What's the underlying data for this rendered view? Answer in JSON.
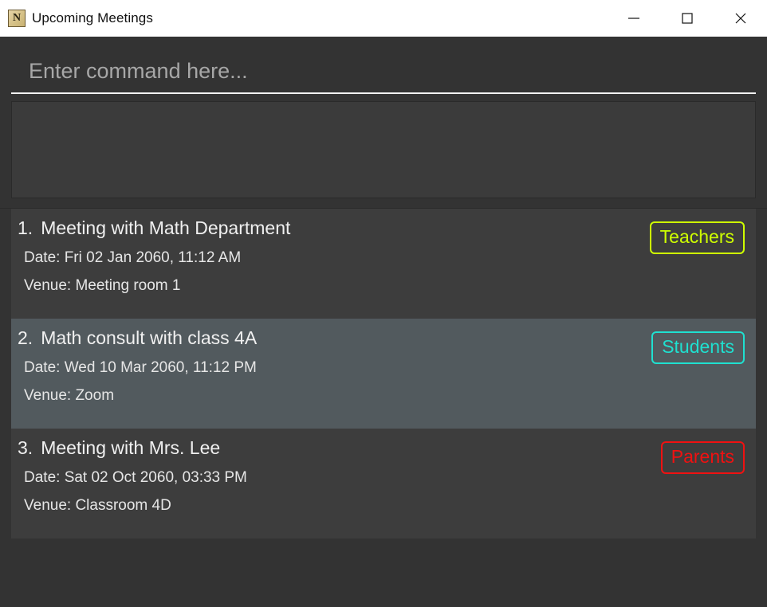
{
  "window": {
    "title": "Upcoming Meetings",
    "icon": "notebook-icon",
    "icon_letter": "N",
    "controls": {
      "minimize": "minimize-icon",
      "maximize": "maximize-icon",
      "close": "close-icon"
    }
  },
  "command": {
    "placeholder": "Enter command here...",
    "value": ""
  },
  "result": {
    "text": ""
  },
  "list": {
    "items": [
      {
        "index": "1.",
        "title": "Meeting with Math Department",
        "date": "Date: Fri 02 Jan 2060, 11:12 AM",
        "venue": "Venue: Meeting room 1",
        "tag": "Teachers",
        "tag_color": "#cfff00",
        "selected": false
      },
      {
        "index": "2.",
        "title": "Math consult with class 4A",
        "date": "Date: Wed 10 Mar 2060, 11:12 PM",
        "venue": "Venue: Zoom",
        "tag": "Students",
        "tag_color": "#1fe0d0",
        "selected": true
      },
      {
        "index": "3.",
        "title": "Meeting with Mrs. Lee",
        "date": "Date: Sat 02 Oct 2060, 03:33 PM",
        "venue": "Venue: Classroom 4D",
        "tag": "Parents",
        "tag_color": "#f01111",
        "selected": false
      }
    ]
  },
  "theme": {
    "window_bg": "#333333",
    "titlebar_bg": "#ffffff",
    "card_bg": "#3d3d3d",
    "card_selected_bg": "#525a5e",
    "text_primary": "#f0f0f0",
    "text_secondary": "#e6e6e6",
    "placeholder": "#a7a7a7",
    "input_underline": "#f2f2f2"
  }
}
